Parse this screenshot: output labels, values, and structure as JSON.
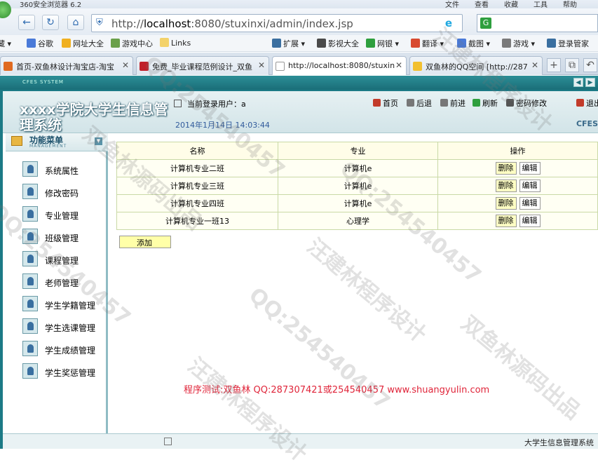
{
  "browser": {
    "app_name": "360安全浏览器 6.2",
    "menus": [
      "文件",
      "查看",
      "收藏",
      "工具",
      "帮助"
    ],
    "address": {
      "prefix": "http://",
      "host": "localhost",
      "rest": ":8080/stuxinxi/admin/index.jsp"
    },
    "bookmarks": [
      {
        "label": "藏",
        "color": "#e0a030"
      },
      {
        "label": "谷歌",
        "color": "#4a7ad8"
      },
      {
        "label": "网址大全",
        "color": "#f0b020"
      },
      {
        "label": "游戏中心",
        "color": "#6aa04a"
      },
      {
        "label": "Links",
        "color": "#f3d26a"
      },
      {
        "label": "扩展",
        "color": "#3a6fa0"
      },
      {
        "label": "影视大全",
        "color": "#4a4a4a"
      },
      {
        "label": "网银",
        "color": "#2e9f3e"
      },
      {
        "label": "翻译",
        "color": "#d84a30"
      },
      {
        "label": "截图",
        "color": "#4a7ad8"
      },
      {
        "label": "游戏",
        "color": "#7a7a7a"
      },
      {
        "label": "登录管家",
        "color": "#3a6fa0"
      }
    ],
    "tabs": [
      {
        "label": "首页-双鱼林设计淘宝店-淘宝",
        "color": "#e06a20"
      },
      {
        "label": "免费_毕业课程范例设计_双鱼",
        "color": "#c0202a"
      },
      {
        "label": "http://localhost:8080/stuxin",
        "color": "#ffffff"
      },
      {
        "label": "双鱼林的QQ空间 [http://287",
        "color": "#f2c030"
      }
    ]
  },
  "app": {
    "header_tag": "CFES SYSTEM",
    "title": "xxxx学院大学生信息管理系统",
    "current_user_label": "当前登录用户：a",
    "datetime": "2014年1月14日  14:03:44",
    "top_links": [
      {
        "label": "首页",
        "color": "#c23b2a"
      },
      {
        "label": "后退",
        "color": "#777777"
      },
      {
        "label": "前进",
        "color": "#777777"
      },
      {
        "label": "刷新",
        "color": "#2e9f3e"
      },
      {
        "label": "密码修改",
        "color": "#555555"
      },
      {
        "label": "退出",
        "color": "#c23b2a"
      }
    ],
    "brand": "CFES"
  },
  "sidebar": {
    "title": "功能菜单",
    "subtitle": "MANAGEMENT",
    "items": [
      "系统属性",
      "修改密码",
      "专业管理",
      "班级管理",
      "课程管理",
      "老师管理",
      "学生学籍管理",
      "学生选课管理",
      "学生成绩管理",
      "学生奖惩管理"
    ]
  },
  "table": {
    "headers": [
      "名称",
      "专业",
      "操作"
    ],
    "rows": [
      {
        "name": "计算机专业二班",
        "major": "计算机e",
        "del": "删除",
        "edit": "编辑"
      },
      {
        "name": "计算机专业三班",
        "major": "计算机e",
        "del": "删除",
        "edit": "编辑"
      },
      {
        "name": "计算机专业四班",
        "major": "计算机e",
        "del": "删除",
        "edit": "编辑"
      },
      {
        "name": "计算机专业一班13",
        "major": "心理学",
        "del": "删除",
        "edit": "编辑"
      }
    ],
    "add_label": "添加"
  },
  "credit": "程序测试:双鱼林 QQ:287307421或254540457 www.shuangyulin.com",
  "status_bar": {
    "system_name": "大学生信息管理系统"
  },
  "watermarks": [
    "QQ:254540457",
    "汪建林程序设计",
    "双鱼林源码出品"
  ]
}
